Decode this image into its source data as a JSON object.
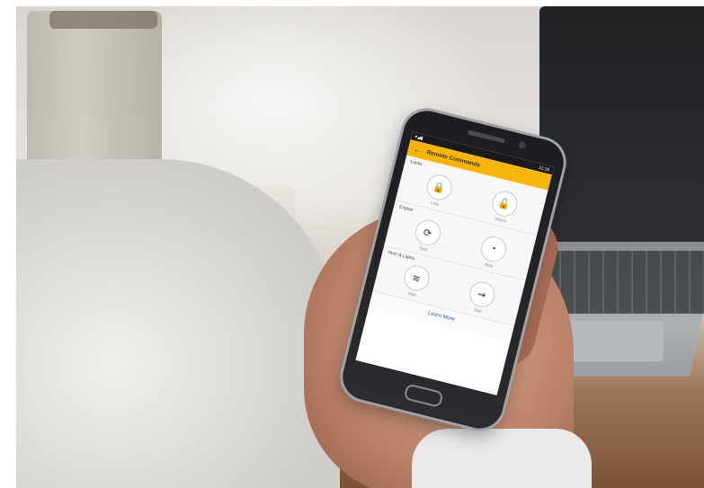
{
  "photo": {
    "description_icons": [
      "coffee-cup",
      "laptop",
      "watch"
    ]
  },
  "app": {
    "status": {
      "icons": "▾◢▮",
      "time": "11:18"
    },
    "title": "Remote Commands",
    "sections": [
      {
        "label": "Locks",
        "commands": [
          {
            "icon": "🔒",
            "label": "Lock"
          },
          {
            "icon": "🔓",
            "label": "Unlock"
          }
        ]
      },
      {
        "label": "Engine",
        "commands": [
          {
            "icon": "⟳",
            "label": "Start"
          },
          {
            "icon": "◔",
            "label": "Stop"
          }
        ]
      },
      {
        "label": "Horn & Lights",
        "commands": [
          {
            "icon": "≋",
            "label": "Start"
          },
          {
            "icon": "⇝",
            "label": "Stop"
          }
        ]
      }
    ],
    "learn_more": "Learn More"
  }
}
